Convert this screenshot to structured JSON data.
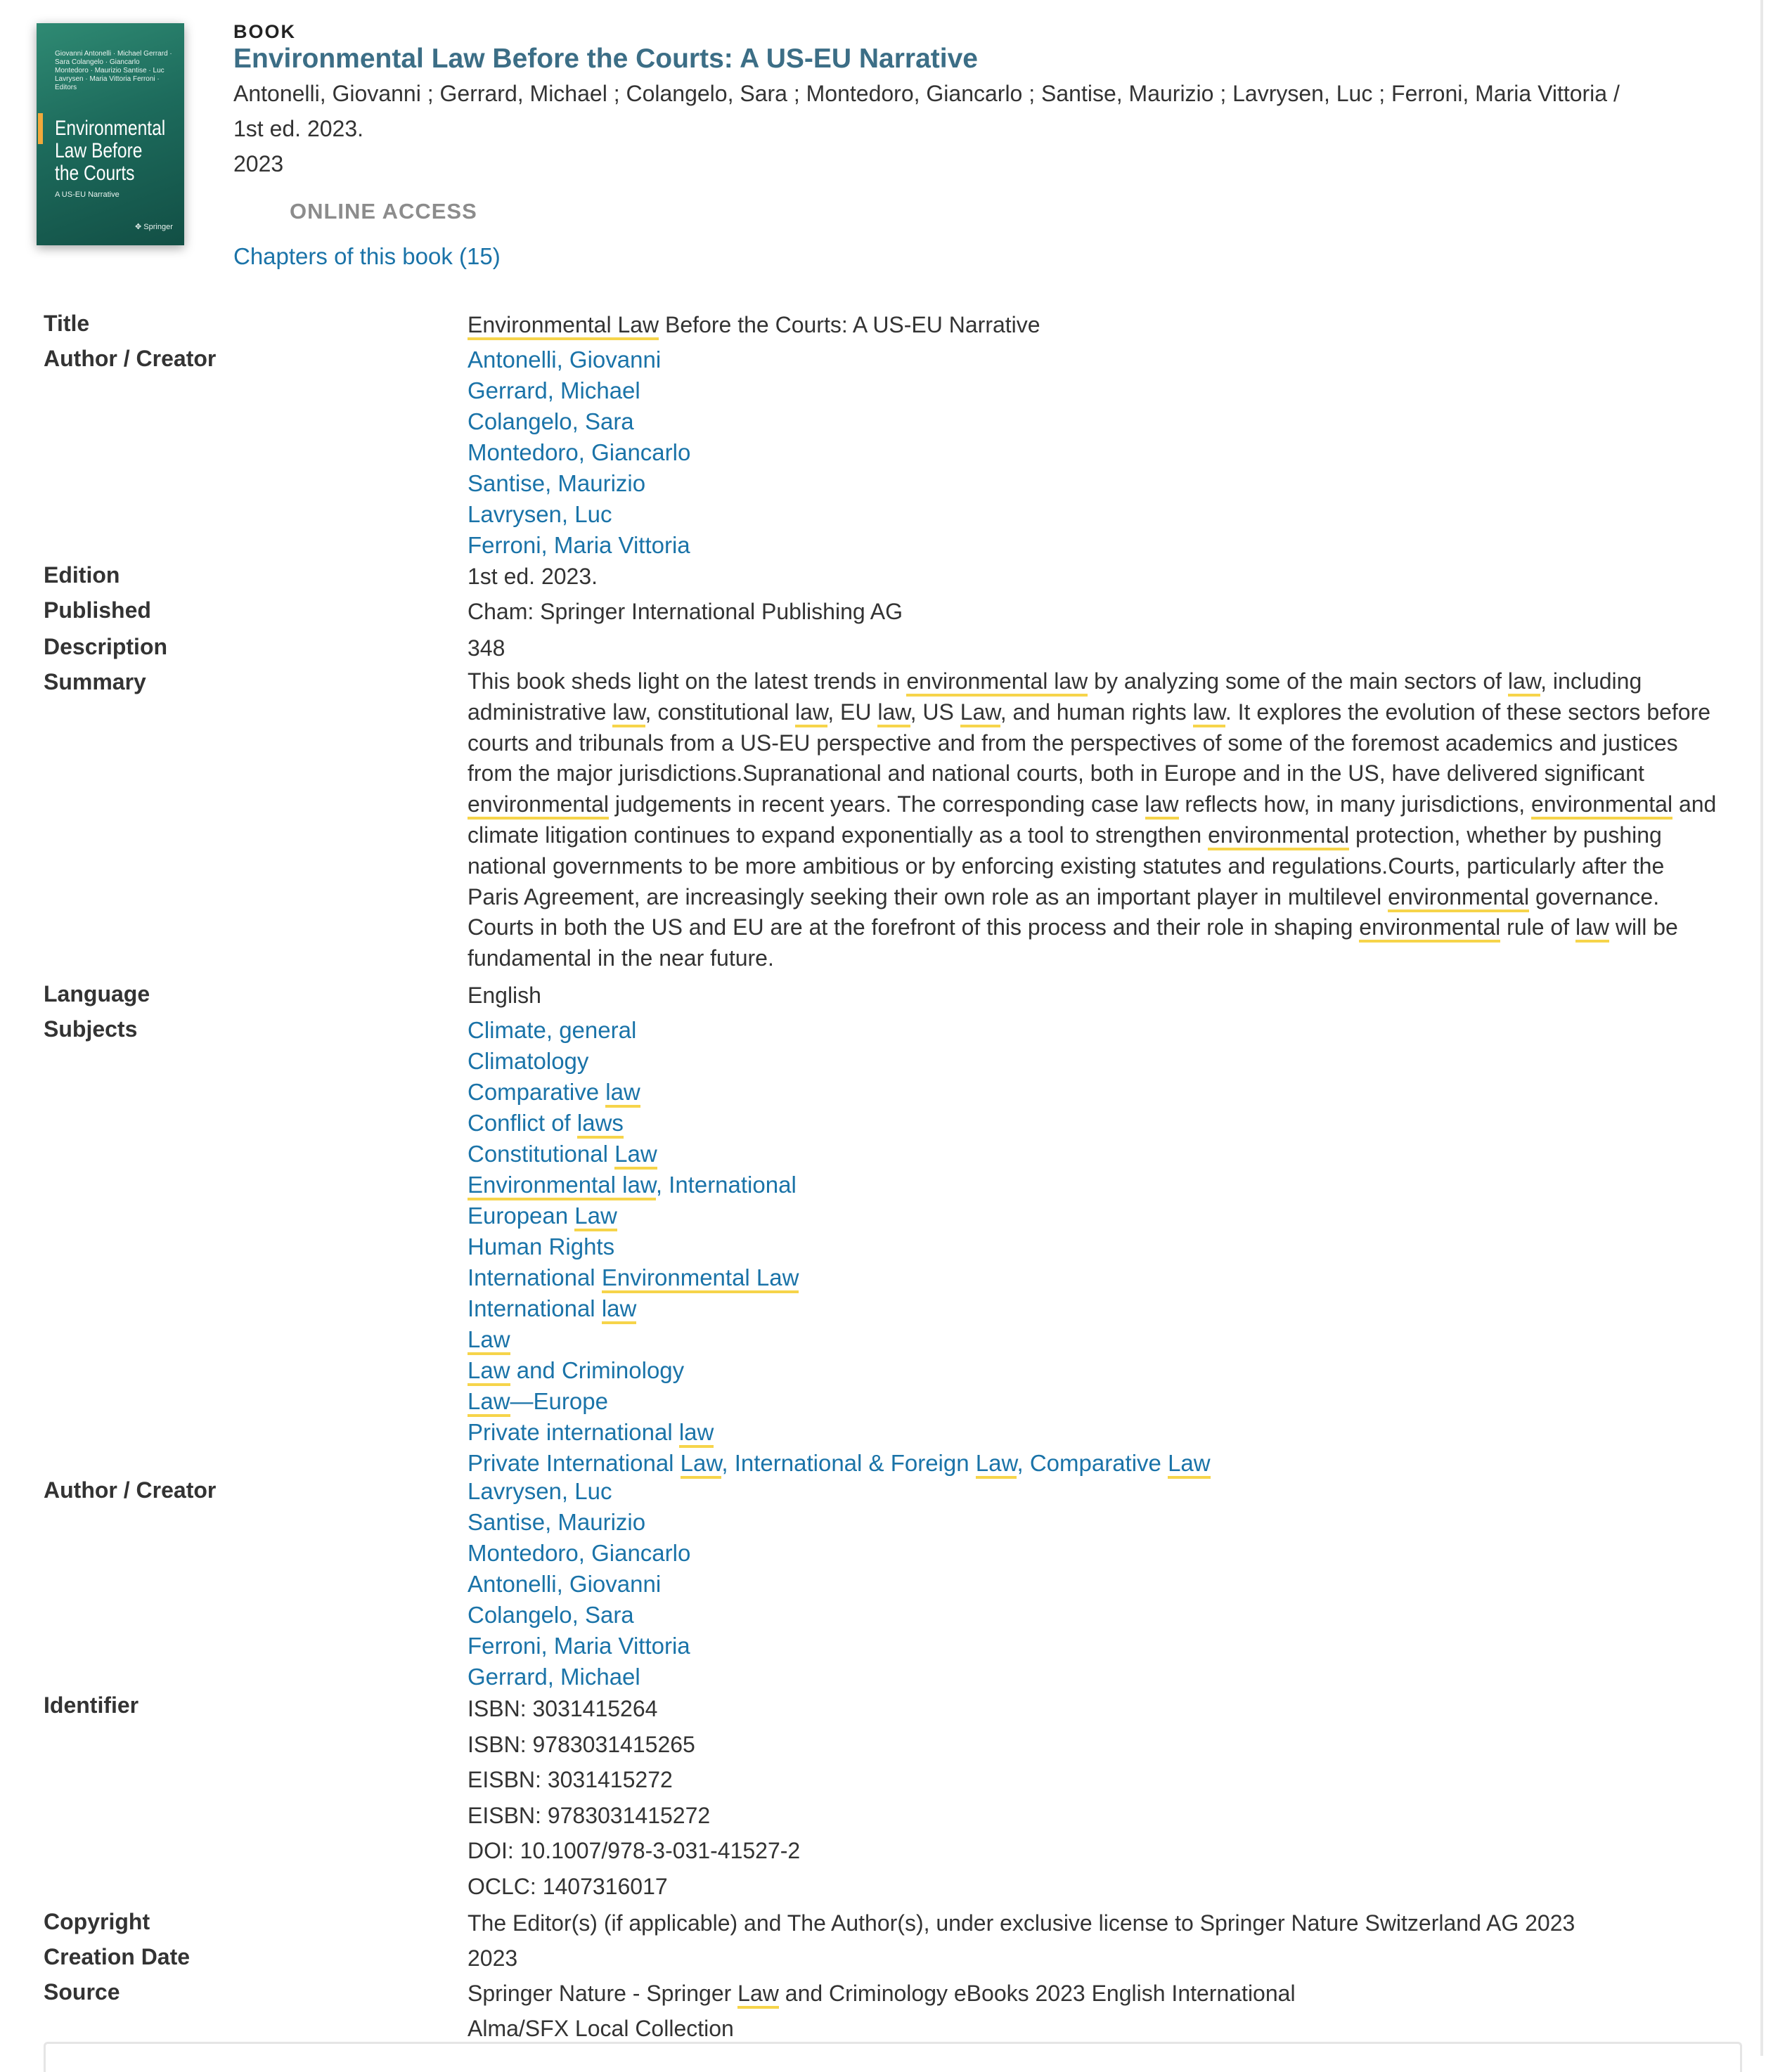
{
  "header": {
    "type_label": "BOOK",
    "title": "Environmental Law Before the Courts: A US-EU Narrative",
    "authors_line": "Antonelli, Giovanni ; Gerrard, Michael ; Colangelo, Sara ; Montedoro, Giancarlo ; Santise, Maurizio ; Lavrysen, Luc ; Ferroni, Maria Vittoria /",
    "edition_line": "1st ed. 2023.",
    "year_line": "2023",
    "online_access": "ONLINE ACCESS",
    "chapters_link": "Chapters of this book (15)"
  },
  "cover": {
    "authors": "Giovanni Antonelli · Michael Gerrard · Sara Colangelo · Giancarlo Montedoro · Maurizio Santise · Luc Lavrysen · Maria Vittoria Ferroni · Editors",
    "title": "Environmental Law Before the Courts",
    "subtitle": "A US-EU Narrative",
    "publisher": "Springer"
  },
  "details": {
    "title_label": "Title",
    "title_pre": "Environmental Law",
    "title_post": " Before the Courts: A US-EU Narrative",
    "author_label": "Author / Creator",
    "authors": [
      "Antonelli, Giovanni",
      "Gerrard, Michael",
      "Colangelo, Sara",
      "Montedoro, Giancarlo",
      "Santise, Maurizio",
      "Lavrysen, Luc",
      "Ferroni, Maria Vittoria"
    ],
    "edition_label": "Edition",
    "edition": "1st ed. 2023.",
    "published_label": "Published",
    "published": "Cham: Springer International Publishing AG",
    "description_label": "Description",
    "description": "348",
    "summary_label": "Summary",
    "summary_parts": [
      "This book sheds light on the latest trends in ",
      "environmental law",
      " by analyzing some of the main sectors of ",
      "law",
      ", including administrative ",
      "law",
      ", constitutional ",
      "law",
      ", EU ",
      "law",
      ", US ",
      "Law",
      ",  and human rights ",
      "law",
      ". It explores the evolution of these sectors before courts and tribunals from a US-EU perspective and from the perspectives of some of the foremost academics and justices from the major jurisdictions.Supranational and national courts, both in Europe and in the US, have delivered significant ",
      "environmental",
      " judgements in recent years. The corresponding case ",
      "law",
      " reflects how, in many jurisdictions, ",
      "environmental",
      " and climate litigation continues to expand exponentially as a tool to strengthen ",
      "environmental",
      " protection, whether by pushing national governments to be more ambitious or by enforcing existing statutes and regulations.Courts, particularly after the Paris Agreement, are increasingly seeking their own role as an important player in multilevel ",
      "environmental",
      " governance. Courts in both the US and EU are at the forefront of this process and their role in shaping ",
      "environmental",
      " rule of ",
      "law",
      " will be fundamental in the near future."
    ],
    "language_label": "Language",
    "language": "English",
    "subjects_label": "Subjects",
    "subjects": [
      [
        [
          "Climate, general",
          0
        ]
      ],
      [
        [
          "Climatology",
          0
        ]
      ],
      [
        [
          "Comparative ",
          0
        ],
        [
          "law",
          1
        ]
      ],
      [
        [
          "Conflict of ",
          0
        ],
        [
          "laws",
          1
        ]
      ],
      [
        [
          "Constitutional ",
          0
        ],
        [
          "Law",
          1
        ]
      ],
      [
        [
          "Environmental law",
          1
        ],
        [
          ", International",
          0
        ]
      ],
      [
        [
          "European ",
          0
        ],
        [
          "Law",
          1
        ]
      ],
      [
        [
          "Human Rights",
          0
        ]
      ],
      [
        [
          "International ",
          0
        ],
        [
          "Environmental Law",
          1
        ]
      ],
      [
        [
          "International ",
          0
        ],
        [
          "law",
          1
        ]
      ],
      [
        [
          "Law",
          1
        ]
      ],
      [
        [
          "Law",
          1
        ],
        [
          " and Criminology",
          0
        ]
      ],
      [
        [
          "Law",
          1
        ],
        [
          "—Europe",
          0
        ]
      ],
      [
        [
          "Private international ",
          0
        ],
        [
          "law",
          1
        ]
      ],
      [
        [
          "Private International ",
          0
        ],
        [
          "Law",
          1
        ],
        [
          ", International & Foreign ",
          0
        ],
        [
          "Law",
          1
        ],
        [
          ", Comparative ",
          0
        ],
        [
          "Law",
          1
        ]
      ]
    ],
    "author2_label": "Author / Creator",
    "authors2": [
      "Lavrysen, Luc",
      "Santise, Maurizio",
      "Montedoro, Giancarlo",
      "Antonelli, Giovanni",
      "Colangelo, Sara",
      "Ferroni, Maria Vittoria",
      "Gerrard, Michael"
    ],
    "identifier_label": "Identifier",
    "identifiers": [
      "ISBN: 3031415264",
      "ISBN: 9783031415265",
      "EISBN: 3031415272",
      "EISBN: 9783031415272",
      "DOI: 10.1007/978-3-031-41527-2",
      "OCLC: 1407316017"
    ],
    "copyright_label": "Copyright",
    "copyright": "The Editor(s) (if applicable) and The Author(s), under exclusive license to Springer Nature Switzerland AG 2023",
    "creation_label": "Creation Date",
    "creation": "2023",
    "source_label": "Source",
    "source_pre": "Springer Nature - Springer ",
    "source_hl": "Law",
    "source_post": " and Criminology eBooks 2023 English International",
    "source2": "Alma/SFX Local Collection"
  }
}
